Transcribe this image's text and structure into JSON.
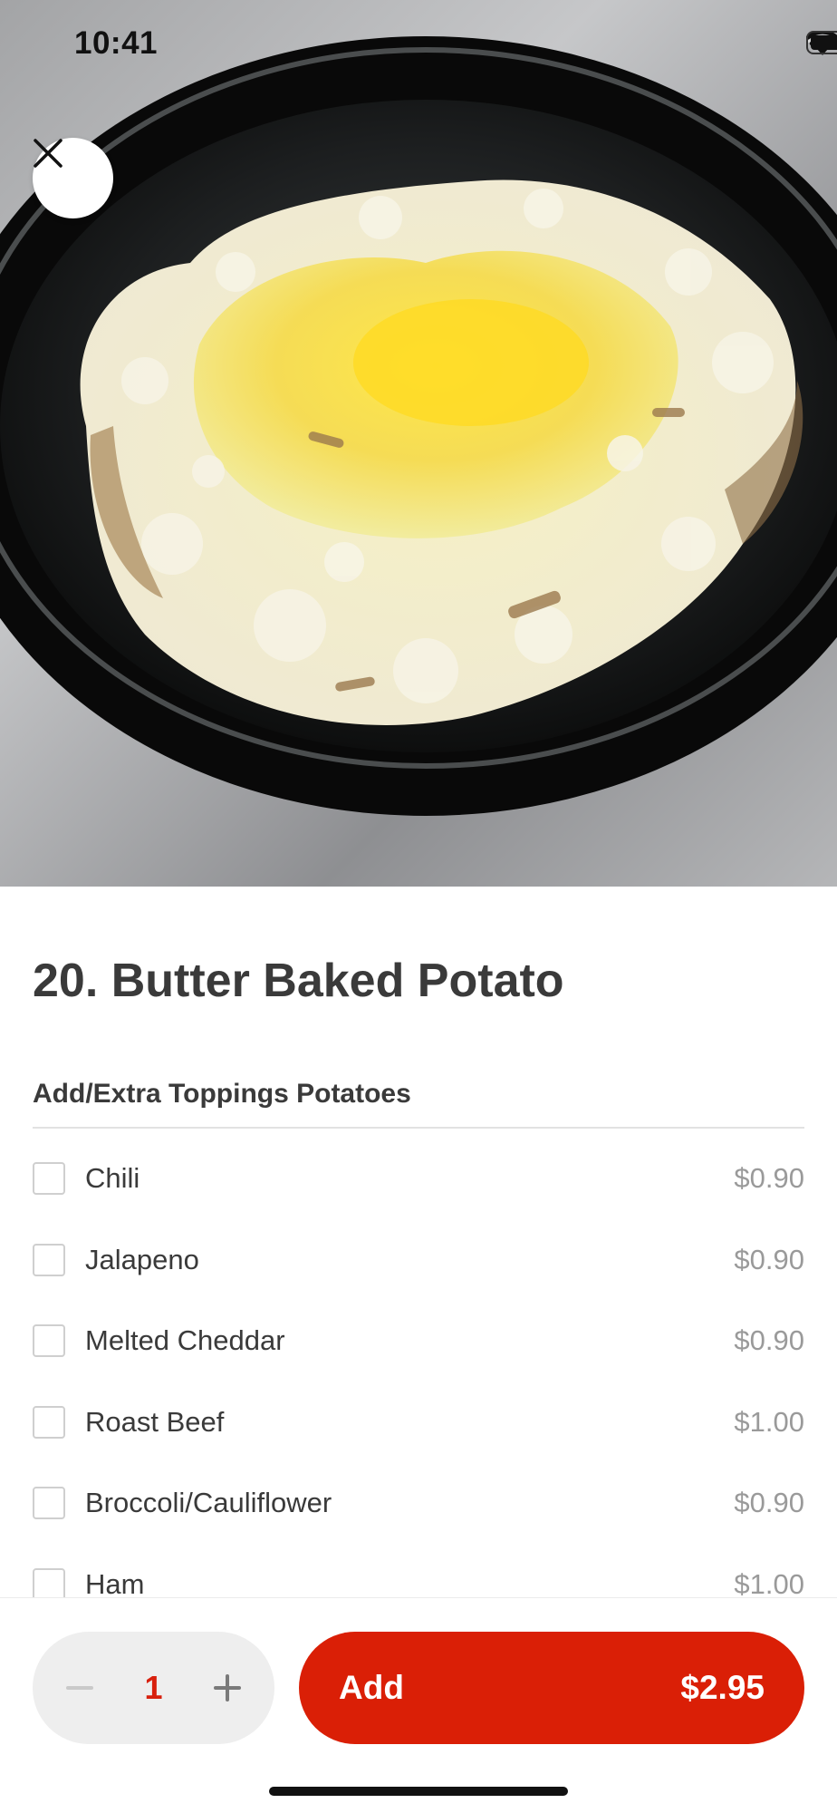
{
  "status_bar": {
    "time": "10:41",
    "icons": [
      "cellular-signal-icon",
      "wifi-icon",
      "battery-icon"
    ]
  },
  "hero_image": {
    "subject": "baked-potato-photo"
  },
  "close_button": {
    "icon": "close-icon"
  },
  "item": {
    "title": "20. Butter Baked Potato"
  },
  "options_group": {
    "title": "Add/Extra Toppings Potatoes",
    "options": [
      {
        "label": "Chili",
        "price": "$0.90",
        "checked": false
      },
      {
        "label": "Jalapeno",
        "price": "$0.90",
        "checked": false
      },
      {
        "label": "Melted Cheddar",
        "price": "$0.90",
        "checked": false
      },
      {
        "label": "Roast Beef",
        "price": "$1.00",
        "checked": false
      },
      {
        "label": "Broccoli/Cauliflower",
        "price": "$0.90",
        "checked": false
      },
      {
        "label": "Ham",
        "price": "$1.00",
        "checked": false
      }
    ]
  },
  "cart": {
    "quantity": "1",
    "minus_icon": "minus-icon",
    "plus_icon": "plus-icon",
    "add_label": "Add",
    "total_price": "$2.95"
  },
  "colors": {
    "accent": "#da1f06",
    "quantity_text": "#d8200d",
    "price_text": "#9a9a9a",
    "title_text": "#3a3a3a"
  }
}
